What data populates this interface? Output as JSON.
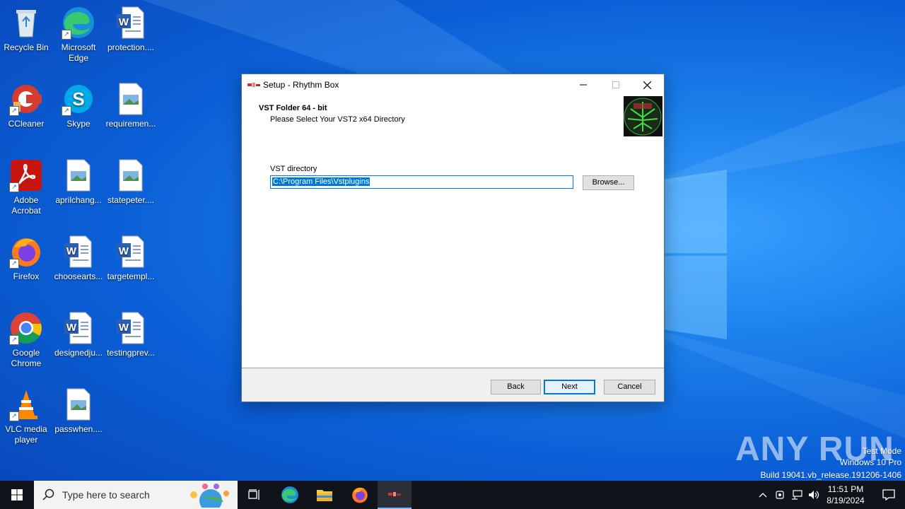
{
  "desktop": {
    "icons": [
      {
        "label": "Recycle Bin"
      },
      {
        "label": "Microsoft Edge"
      },
      {
        "label": "protection...."
      },
      {
        "label": "CCleaner"
      },
      {
        "label": "Skype"
      },
      {
        "label": "requiremen..."
      },
      {
        "label": "Adobe Acrobat"
      },
      {
        "label": "aprilchang..."
      },
      {
        "label": "statepeter...."
      },
      {
        "label": "Firefox"
      },
      {
        "label": "choosearts..."
      },
      {
        "label": "targetempl..."
      },
      {
        "label": "Google Chrome"
      },
      {
        "label": "designedju..."
      },
      {
        "label": "testingprev..."
      },
      {
        "label": "VLC media player"
      },
      {
        "label": "passwhen...."
      }
    ]
  },
  "dialog": {
    "title": "Setup - Rhythm Box",
    "header_title": "VST Folder 64 - bit",
    "header_subtitle": "Please Select Your VST2 x64 Directory",
    "field_label": "VST directory",
    "field_value": "C:\\Program Files\\Vstplugins",
    "browse_label": "Browse...",
    "back_label": "Back",
    "next_label": "Next",
    "cancel_label": "Cancel"
  },
  "watermark": {
    "brand": "ANY RUN",
    "line1": "Test Mode",
    "line2": "Windows 10 Pro",
    "line3": "Build 19041.vb_release.191206-1406"
  },
  "taskbar": {
    "search_placeholder": "Type here to search",
    "time": "11:51 PM",
    "date": "8/19/2024"
  },
  "colors": {
    "accent": "#0078d7",
    "taskbar": "#10131a",
    "desktop": "#0b5fd6"
  }
}
